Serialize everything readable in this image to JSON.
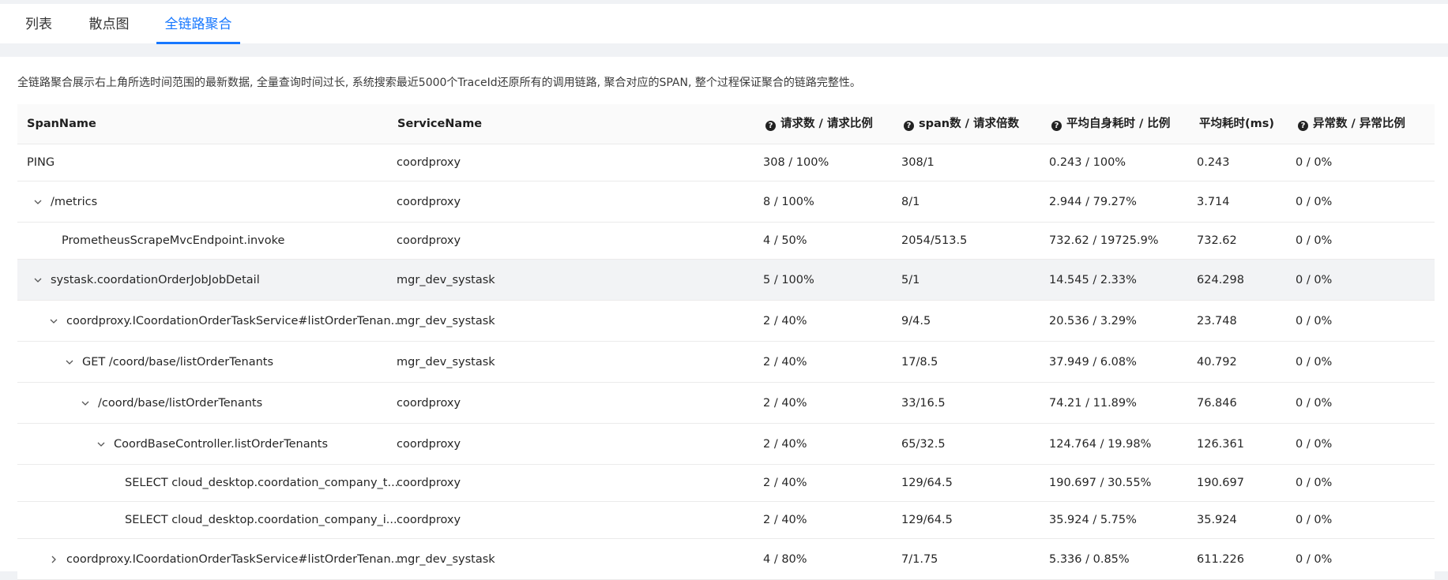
{
  "tabs": [
    {
      "label": "列表",
      "active": false
    },
    {
      "label": "散点图",
      "active": false
    },
    {
      "label": "全链路聚合",
      "active": true
    }
  ],
  "notice": "全链路聚合展示右上角所选时间范围的最新数据, 全量查询时间过长, 系统搜索最近5000个TraceId还原所有的调用链路, 聚合对应的SPAN, 整个过程保证聚合的链路完整性。",
  "accent_color": "#1677ff",
  "columns": {
    "span_name": "SpanName",
    "service_name": "ServiceName",
    "requests": "请求数 / 请求比例",
    "spans": "span数 / 请求倍数",
    "self_time": "平均自身耗时 / 比例",
    "avg_time": "平均耗时(ms)",
    "errors": "异常数 / 异常比例"
  },
  "rows": [
    {
      "span": "PING",
      "service": "coordproxy",
      "requests": "308 / 100%",
      "spans": "308/1",
      "self_time": "0.243 / 100%",
      "avg_time": "0.243",
      "errors": "0 / 0%"
    },
    {
      "span": "/metrics",
      "service": "coordproxy",
      "requests": "8 / 100%",
      "spans": "8/1",
      "self_time": "2.944 / 79.27%",
      "avg_time": "3.714",
      "errors": "0 / 0%"
    },
    {
      "span": "PrometheusScrapeMvcEndpoint.invoke",
      "service": "coordproxy",
      "requests": "4 / 50%",
      "spans": "2054/513.5",
      "self_time": "732.62 / 19725.9%",
      "avg_time": "732.62",
      "errors": "0 / 0%"
    },
    {
      "span": "systask.coordationOrderJobJobDetail",
      "service": "mgr_dev_systask",
      "requests": "5 / 100%",
      "spans": "5/1",
      "self_time": "14.545 / 2.33%",
      "avg_time": "624.298",
      "errors": "0 / 0%"
    },
    {
      "span": "coordproxy.ICoordationOrderTaskService#listOrderTenan...",
      "service": "mgr_dev_systask",
      "requests": "2 / 40%",
      "spans": "9/4.5",
      "self_time": "20.536 / 3.29%",
      "avg_time": "23.748",
      "errors": "0 / 0%"
    },
    {
      "span": "GET /coord/base/listOrderTenants",
      "service": "mgr_dev_systask",
      "requests": "2 / 40%",
      "spans": "17/8.5",
      "self_time": "37.949 / 6.08%",
      "avg_time": "40.792",
      "errors": "0 / 0%"
    },
    {
      "span": "/coord/base/listOrderTenants",
      "service": "coordproxy",
      "requests": "2 / 40%",
      "spans": "33/16.5",
      "self_time": "74.21 / 11.89%",
      "avg_time": "76.846",
      "errors": "0 / 0%"
    },
    {
      "span": "CoordBaseController.listOrderTenants",
      "service": "coordproxy",
      "requests": "2 / 40%",
      "spans": "65/32.5",
      "self_time": "124.764 / 19.98%",
      "avg_time": "126.361",
      "errors": "0 / 0%"
    },
    {
      "span": "SELECT cloud_desktop.coordation_company_t...",
      "service": "coordproxy",
      "requests": "2 / 40%",
      "spans": "129/64.5",
      "self_time": "190.697 / 30.55%",
      "avg_time": "190.697",
      "errors": "0 / 0%"
    },
    {
      "span": "SELECT cloud_desktop.coordation_company_i...",
      "service": "coordproxy",
      "requests": "2 / 40%",
      "spans": "129/64.5",
      "self_time": "35.924 / 5.75%",
      "avg_time": "35.924",
      "errors": "0 / 0%"
    },
    {
      "span": "coordproxy.ICoordationOrderTaskService#listOrderTenan...",
      "service": "mgr_dev_systask",
      "requests": "4 / 80%",
      "spans": "7/1.75",
      "self_time": "5.336 / 0.85%",
      "avg_time": "611.226",
      "errors": "0 / 0%"
    }
  ]
}
